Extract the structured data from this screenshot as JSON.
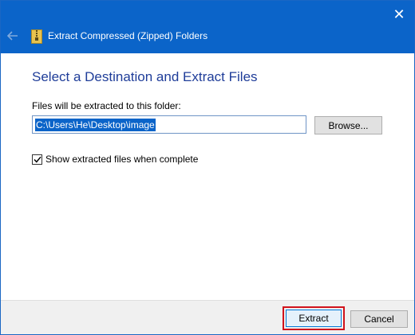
{
  "window": {
    "title": "Extract Compressed (Zipped) Folders",
    "close_glyph": "✕",
    "back_icon": "back-arrow-icon",
    "app_icon": "zip-folder-icon"
  },
  "main": {
    "heading": "Select a Destination and Extract Files",
    "destination_label": "Files will be extracted to this folder:",
    "destination_path": "C:\\Users\\He\\Desktop\\image",
    "browse_label": "Browse...",
    "show_files_label": "Show extracted files when complete",
    "show_files_checked": true
  },
  "footer": {
    "extract_label": "Extract",
    "cancel_label": "Cancel"
  },
  "colors": {
    "titlebar": "#0b64c9",
    "heading": "#1f3d99",
    "selection": "#0b64c9",
    "highlight_outline": "#d0121b"
  }
}
